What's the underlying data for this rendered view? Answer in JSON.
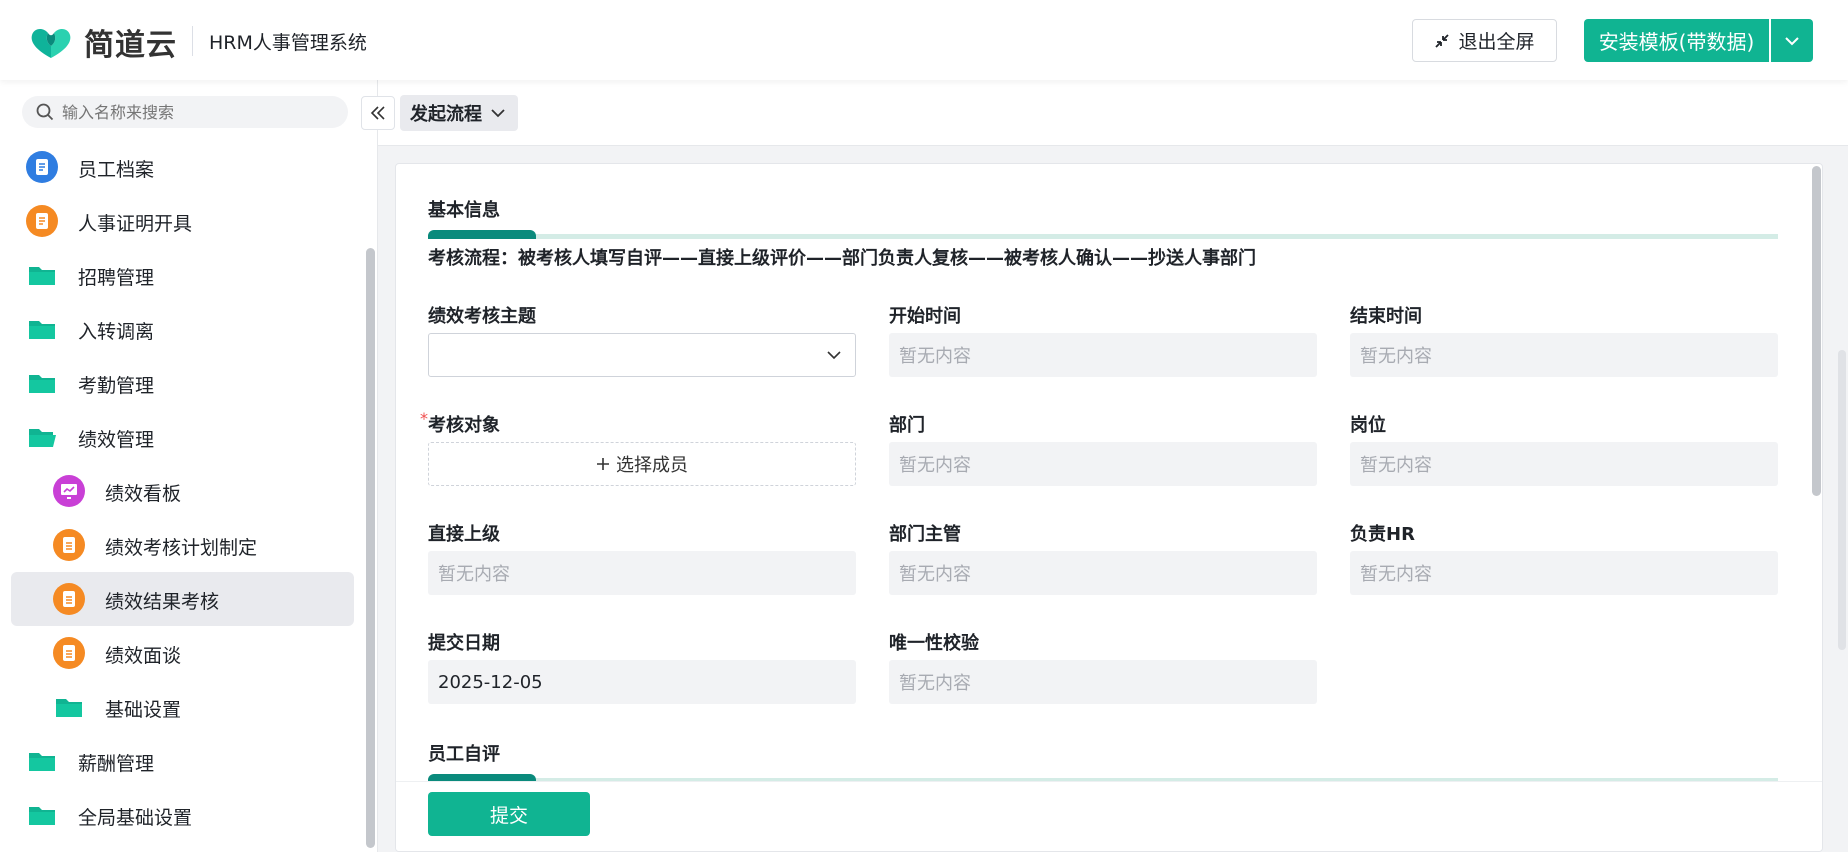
{
  "header": {
    "logo_text": "简道云",
    "app_title": "HRM人事管理系统",
    "exit_fullscreen_label": "退出全屏",
    "install_template_label": "安装模板(带数据)",
    "brand_color": "#10b492"
  },
  "sidebar": {
    "search": {
      "placeholder": "输入名称来搜索"
    },
    "items": [
      {
        "label": "员工档案",
        "icon": "document-icon",
        "level": 1
      },
      {
        "label": "人事证明开具",
        "icon": "form-icon",
        "level": 1
      },
      {
        "label": "招聘管理",
        "icon": "folder-icon",
        "level": 1
      },
      {
        "label": "入转调离",
        "icon": "folder-icon",
        "level": 1
      },
      {
        "label": "考勤管理",
        "icon": "folder-icon",
        "level": 1
      },
      {
        "label": "绩效管理",
        "icon": "folder-open-icon",
        "level": 1
      },
      {
        "label": "绩效看板",
        "icon": "dashboard-icon",
        "level": 2
      },
      {
        "label": "绩效考核计划制定",
        "icon": "form-icon",
        "level": 2
      },
      {
        "label": "绩效结果考核",
        "icon": "form-icon",
        "level": 2,
        "active": true
      },
      {
        "label": "绩效面谈",
        "icon": "form-icon",
        "level": 2
      },
      {
        "label": "基础设置",
        "icon": "folder-icon",
        "level": 2
      },
      {
        "label": "薪酬管理",
        "icon": "folder-icon",
        "level": 1
      },
      {
        "label": "全局基础设置",
        "icon": "folder-icon",
        "level": 1
      }
    ]
  },
  "toolbar": {
    "flow_label": "发起流程"
  },
  "form": {
    "section_basic": "基本信息",
    "flow_text": "考核流程：被考核人填写自评——直接上级评价——部门负责人复核——被考核人确认——抄送人事部门",
    "fields": {
      "theme": {
        "label": "绩效考核主题",
        "value": ""
      },
      "start": {
        "label": "开始时间",
        "value": "暂无内容"
      },
      "end": {
        "label": "结束时间",
        "value": "暂无内容"
      },
      "target": {
        "label": "考核对象",
        "button": "选择成员",
        "required": "*"
      },
      "dept": {
        "label": "部门",
        "value": "暂无内容"
      },
      "post": {
        "label": "岗位",
        "value": "暂无内容"
      },
      "superior": {
        "label": "直接上级",
        "value": "暂无内容"
      },
      "manager": {
        "label": "部门主管",
        "value": "暂无内容"
      },
      "hr": {
        "label": "负责HR",
        "value": "暂无内容"
      },
      "submit_date": {
        "label": "提交日期",
        "value": "2025-12-05"
      },
      "unique": {
        "label": "唯一性校验",
        "value": "暂无内容"
      }
    },
    "section_self": "员工自评",
    "submit_label": "提交"
  }
}
